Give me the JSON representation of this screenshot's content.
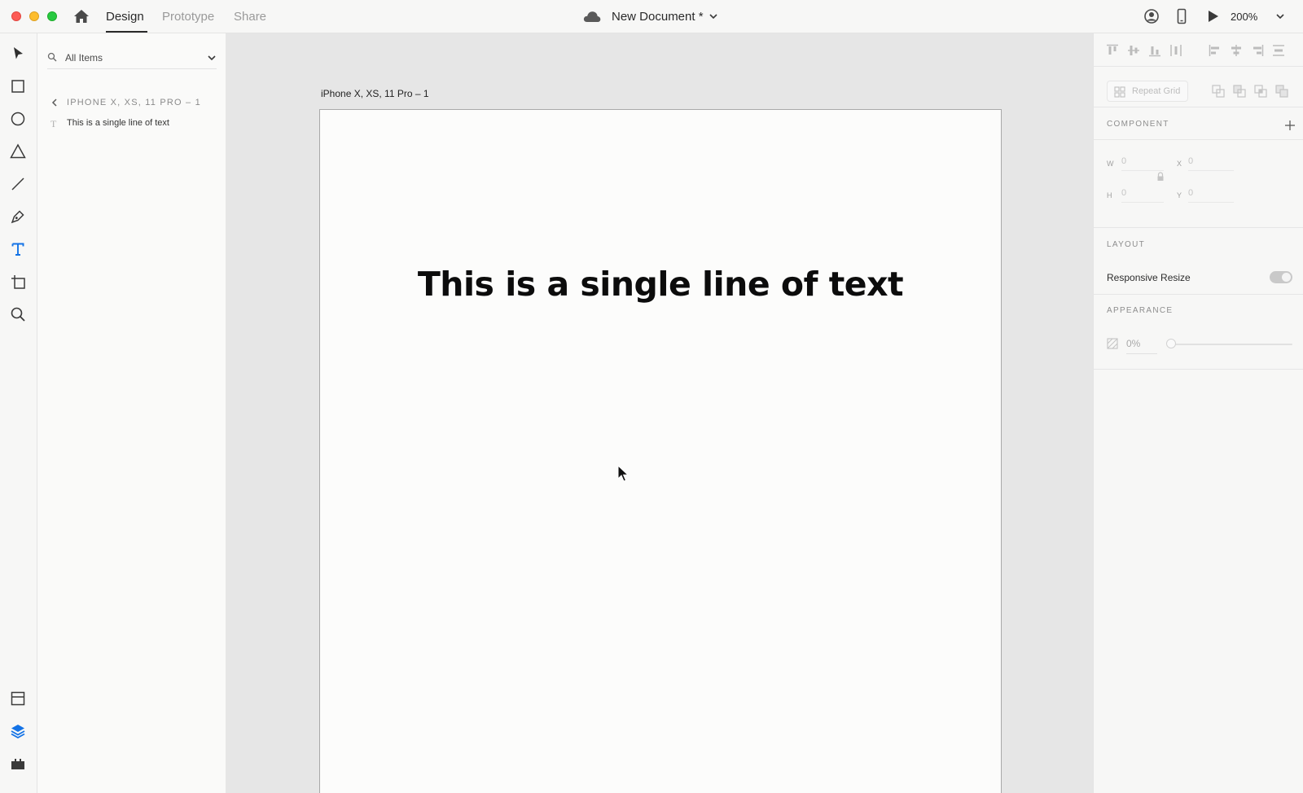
{
  "window": {
    "tabs": [
      {
        "label": "Design",
        "active": true
      },
      {
        "label": "Prototype",
        "active": false
      },
      {
        "label": "Share",
        "active": false
      }
    ],
    "document_title": "New Document *",
    "zoom": "200%"
  },
  "toolbar": {
    "tools": [
      "select-tool",
      "rectangle-tool",
      "ellipse-tool",
      "polygon-tool",
      "line-tool",
      "pen-tool",
      "text-tool",
      "artboard-tool",
      "zoom-tool"
    ],
    "active_tool": "text-tool",
    "bottom": [
      "assets-panel",
      "layers-panel",
      "plugins-panel"
    ],
    "active_bottom": "layers-panel",
    "accent_color": "#1473e6"
  },
  "layers": {
    "search_label": "All Items",
    "artboard_name": "IPHONE X, XS, 11 PRO – 1",
    "items": [
      {
        "type": "text",
        "name": "This is a single line of text"
      }
    ]
  },
  "canvas": {
    "artboard_label": "iPhone X, XS, 11 Pro – 1",
    "text_content": "This is a single line of text"
  },
  "inspector": {
    "repeat_grid_label": "Repeat Grid",
    "component_title": "COMPONENT",
    "dimensions": {
      "w_label": "W",
      "w_value": "0",
      "h_label": "H",
      "h_value": "0",
      "x_label": "X",
      "x_value": "0",
      "y_label": "Y",
      "y_value": "0"
    },
    "layout_title": "LAYOUT",
    "responsive_resize_label": "Responsive Resize",
    "responsive_resize_on": true,
    "appearance_title": "APPEARANCE",
    "opacity_value": "0%",
    "opacity_fraction": 0.0
  }
}
